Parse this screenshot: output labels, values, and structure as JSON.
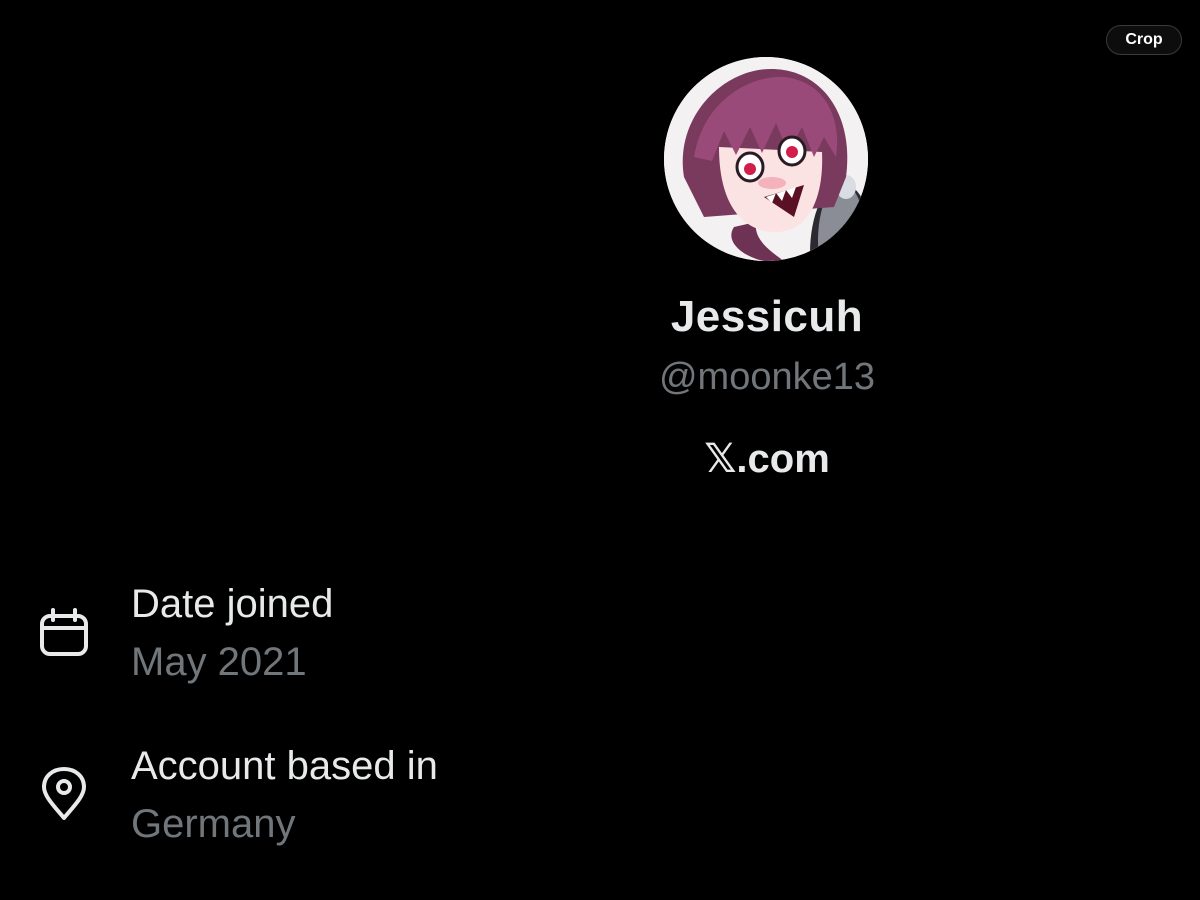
{
  "toolbar": {
    "crop_label": "Crop"
  },
  "profile": {
    "display_name": "Jessicuh",
    "handle": "@moonke13",
    "source": "𝕏.com",
    "avatar": "anime-girl-avatar"
  },
  "details": {
    "date_joined": {
      "icon": "calendar-icon",
      "label": "Date joined",
      "value": "May 2021"
    },
    "account_location": {
      "icon": "location-pin-icon",
      "label": "Account based in",
      "value": "Germany"
    }
  },
  "colors": {
    "background": "#000000",
    "primary_text": "#e7e9ea",
    "secondary_text": "#71767b"
  }
}
